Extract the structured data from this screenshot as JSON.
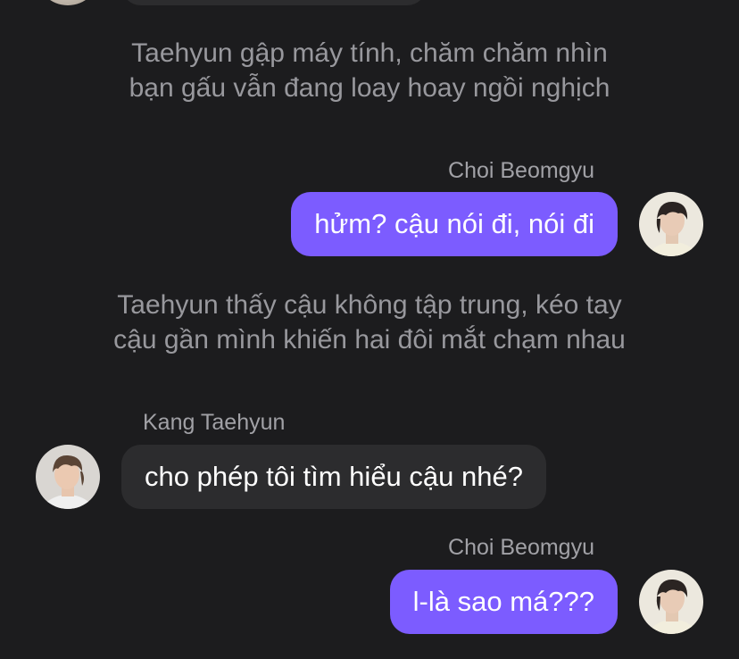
{
  "chat": {
    "narration_1": {
      "line1": "Taehyun gập máy tính, chăm chăm nhìn",
      "line2": "bạn gấu vẫn đang loay hoay ngồi nghịch"
    },
    "message_1": {
      "sender": "Choi Beomgyu",
      "text": "hửm? cậu nói đi, nói đi"
    },
    "narration_2": {
      "line1": "Taehyun thấy cậu không tập trung, kéo tay",
      "line2": "cậu gần mình khiến hai đôi mắt chạm nhau"
    },
    "message_2": {
      "sender": "Kang Taehyun",
      "text": "cho phép tôi tìm hiểu cậu nhé?"
    },
    "message_3": {
      "sender": "Choi Beomgyu",
      "text": "l-là sao má???"
    }
  },
  "colors": {
    "background": "#1c1c1e",
    "outgoing_bubble": "#7c5cff",
    "incoming_bubble": "#2c2c2e",
    "narration_text": "#98989d",
    "sender_name": "#a1a1a6"
  },
  "icons": {
    "beomgyu_avatar": "user-photo-avatar",
    "taehyun_avatar": "user-photo-avatar"
  }
}
